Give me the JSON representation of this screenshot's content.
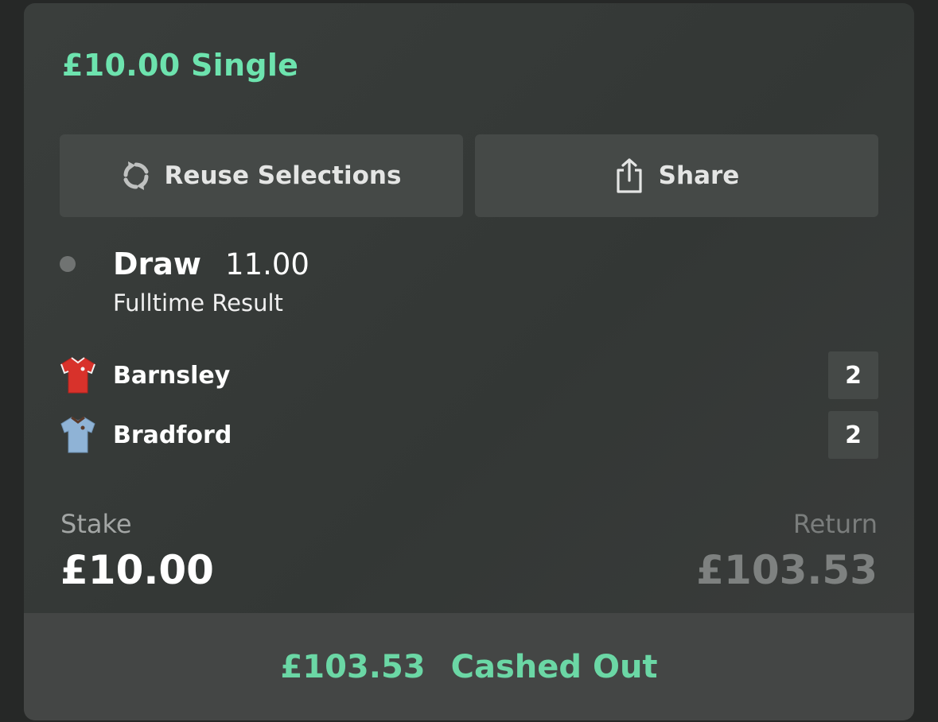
{
  "bet": {
    "title": "£10.00 Single"
  },
  "actions": {
    "reuse_label": "Reuse Selections",
    "share_label": "Share"
  },
  "selection": {
    "name": "Draw",
    "odds": "11.00",
    "market": "Fulltime Result"
  },
  "teams": [
    {
      "name": "Barnsley",
      "score": "2",
      "shirt_color": "#d8322b"
    },
    {
      "name": "Bradford",
      "score": "2",
      "shirt_color": "#8fb3d6"
    }
  ],
  "stake": {
    "label": "Stake",
    "value": "£10.00"
  },
  "return": {
    "label": "Return",
    "value": "£103.53"
  },
  "cashout": {
    "amount": "£103.53",
    "status": "Cashed Out"
  },
  "colors": {
    "accent": "#6de3ae",
    "card_bg": "#363a38",
    "button_bg": "#454947"
  }
}
